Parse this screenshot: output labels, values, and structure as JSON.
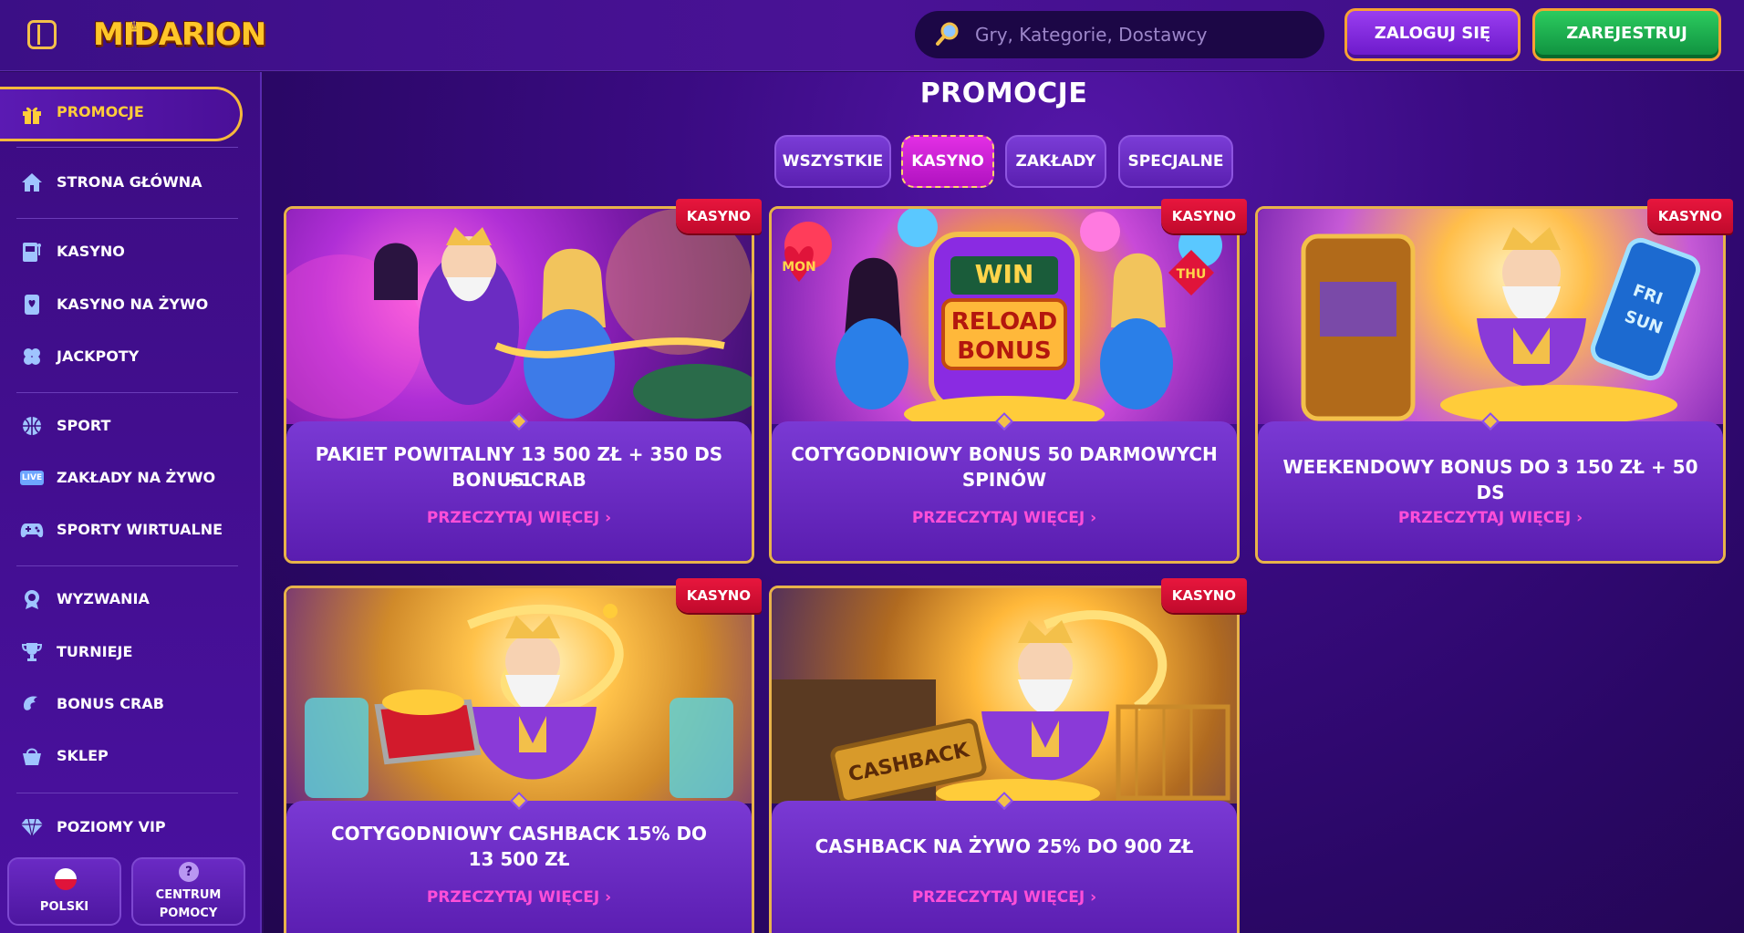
{
  "header": {
    "logo": "MIDARION",
    "search_placeholder": "Gry, Kategorie, Dostawcy",
    "login_label": "ZALOGUJ SIĘ",
    "register_label": "ZAREJESTRUJ"
  },
  "sidebar": {
    "items": [
      {
        "label": "PROMOCJE",
        "icon": "gift-icon"
      },
      {
        "label": "STRONA GŁÓWNA",
        "icon": "home-icon"
      },
      {
        "label": "KASYNO",
        "icon": "slot-machine-icon"
      },
      {
        "label": "KASYNO NA ŻYWO",
        "icon": "cards-icon"
      },
      {
        "label": "JACKPOTY",
        "icon": "clover-icon"
      },
      {
        "label": "SPORT",
        "icon": "basketball-icon"
      },
      {
        "label": "ZAKŁADY NA ŻYWO",
        "icon": "live-icon"
      },
      {
        "label": "SPORTY WIRTUALNE",
        "icon": "gamepad-icon"
      },
      {
        "label": "WYZWANIA",
        "icon": "badge-icon"
      },
      {
        "label": "TURNIEJE",
        "icon": "trophy-icon"
      },
      {
        "label": "BONUS CRAB",
        "icon": "claw-icon"
      },
      {
        "label": "SKLEP",
        "icon": "basket-icon"
      },
      {
        "label": "POZIOMY VIP",
        "icon": "diamond-icon"
      }
    ],
    "live_badge": "LIVE",
    "language_label": "POLSKI",
    "help_label_1": "CENTRUM",
    "help_label_2": "POMOCY",
    "help_icon": "?"
  },
  "main": {
    "title": "PROMOCJE",
    "tabs": [
      "WSZYSTKIE",
      "KASYNO",
      "ZAKŁADY",
      "SPECJALNE"
    ],
    "active_tab": "KASYNO",
    "cards": [
      {
        "badge": "KASYNO",
        "title_1": "PAKIET POWITALNY 13 500 ZŁ + 350 DS +1",
        "title_2": "BONUS CRAB",
        "link": "PRZECZYTAJ WIĘCEJ  ›"
      },
      {
        "badge": "KASYNO",
        "title_1": "COTYGODNIOWY BONUS 50 DARMOWYCH",
        "title_2": "SPINÓW",
        "link": "PRZECZYTAJ WIĘCEJ  ›",
        "img_text_1": "WIN",
        "img_text_2": "RELOAD",
        "img_text_3": "BONUS",
        "img_text_mon": "MON",
        "img_text_thu": "THU"
      },
      {
        "badge": "KASYNO",
        "title_1": "WEEKENDOWY BONUS DO 3 150 ZŁ + 50 DS",
        "title_2": "",
        "link": "PRZECZYTAJ WIĘCEJ  ›",
        "img_text_1": "FRI",
        "img_text_2": "SUN"
      },
      {
        "badge": "KASYNO",
        "title_1": "COTYGODNIOWY CASHBACK 15% DO",
        "title_2": "13 500 ZŁ",
        "link": "PRZECZYTAJ WIĘCEJ  ›"
      },
      {
        "badge": "KASYNO",
        "title_1": "CASHBACK NA ŻYWO 25% DO 900 ZŁ",
        "title_2": "",
        "link": "PRZECZYTAJ WIĘCEJ  ›",
        "img_text_1": "CASHBACK"
      }
    ]
  },
  "colors": {
    "accent_gold": "#f3c04a",
    "active_tab": "#d424d8",
    "link_pink": "#ff4fd8",
    "ribbon_red": "#e0143a",
    "register_green": "#1fb552",
    "login_purple": "#8a30e6"
  }
}
